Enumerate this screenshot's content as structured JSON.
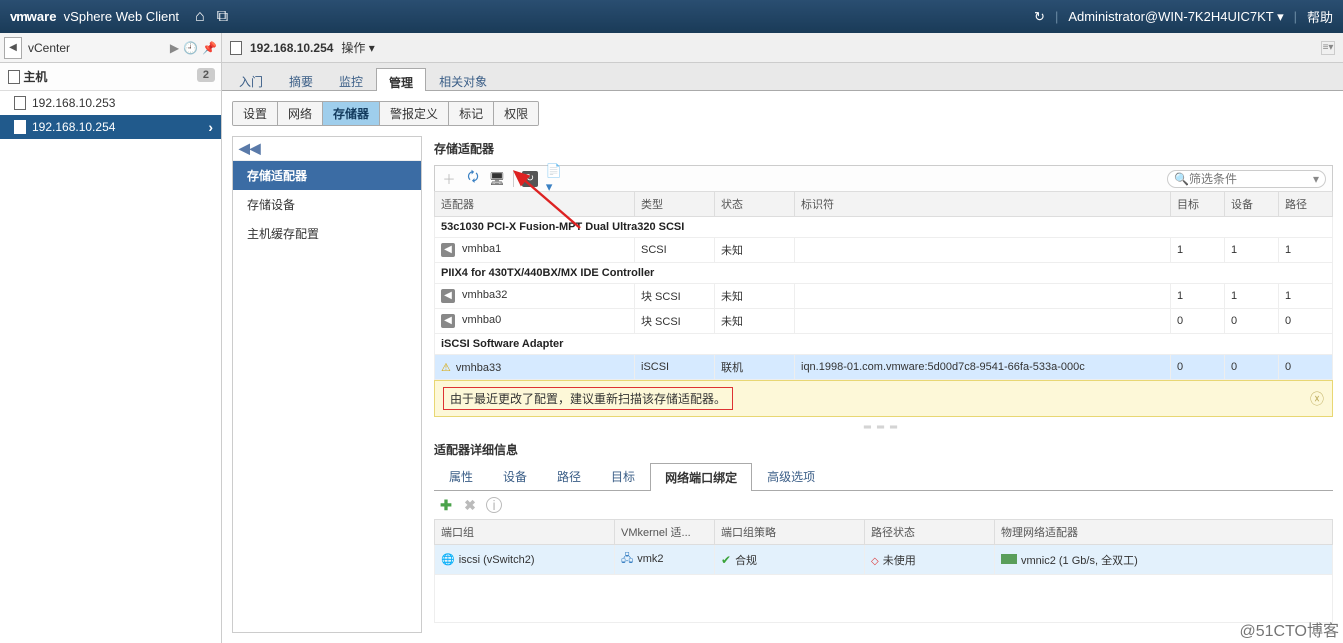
{
  "topbar": {
    "brand_prefix": "vm",
    "brand_suffix": "ware",
    "product": "vSphere Web Client",
    "user": "Administrator@WIN-7K2H4UIC7KT",
    "help": "帮助"
  },
  "left": {
    "breadcrumb": "vCenter",
    "section_title": "主机",
    "badge": "2",
    "hosts": [
      "192.168.10.253",
      "192.168.10.254"
    ],
    "selected": "192.168.10.254"
  },
  "object": {
    "title": "192.168.10.254",
    "actions_label": "操作 ▾"
  },
  "main_tabs": [
    "入门",
    "摘要",
    "监控",
    "管理",
    "相关对象"
  ],
  "main_tab_active": "管理",
  "sub_tabs": [
    "设置",
    "网络",
    "存储器",
    "警报定义",
    "标记",
    "权限"
  ],
  "sub_tab_active": "存储器",
  "inner_nav": {
    "collapse": "◀◀",
    "items": [
      "存储适配器",
      "存储设备",
      "主机缓存配置"
    ],
    "active": "存储适配器"
  },
  "adapters_section_title": "存储适配器",
  "filter_placeholder": "筛选条件",
  "adapter_table": {
    "headers": [
      "适配器",
      "类型",
      "状态",
      "标识符",
      "目标",
      "设备",
      "路径"
    ],
    "groups": [
      {
        "title": "53c1030 PCI-X Fusion-MPT Dual Ultra320 SCSI",
        "rows": [
          {
            "adapter": "vmhba1",
            "type": "SCSI",
            "status": "未知",
            "ident": "",
            "targets": "1",
            "devices": "1",
            "paths": "1",
            "icon": "hba"
          }
        ]
      },
      {
        "title": "PIIX4 for 430TX/440BX/MX IDE Controller",
        "rows": [
          {
            "adapter": "vmhba32",
            "type": "块 SCSI",
            "status": "未知",
            "ident": "",
            "targets": "1",
            "devices": "1",
            "paths": "1",
            "icon": "hba"
          },
          {
            "adapter": "vmhba0",
            "type": "块 SCSI",
            "status": "未知",
            "ident": "",
            "targets": "0",
            "devices": "0",
            "paths": "0",
            "icon": "hba"
          }
        ]
      },
      {
        "title": "iSCSI Software Adapter",
        "rows": [
          {
            "adapter": "vmhba33",
            "type": "iSCSI",
            "status": "联机",
            "ident": "iqn.1998-01.com.vmware:5d00d7c8-9541-66fa-533a-000c",
            "targets": "0",
            "devices": "0",
            "paths": "0",
            "icon": "warn",
            "selected": true
          }
        ]
      }
    ]
  },
  "alert_message": "由于最近更改了配置，建议重新扫描该存储适配器。",
  "detail_title": "适配器详细信息",
  "detail_tabs": [
    "属性",
    "设备",
    "路径",
    "目标",
    "网络端口绑定",
    "高级选项"
  ],
  "detail_tab_active": "网络端口绑定",
  "binding_table": {
    "headers": [
      "端口组",
      "VMkernel 适...",
      "端口组策略",
      "路径状态",
      "物理网络适配器"
    ],
    "row": {
      "portgroup": "iscsi (vSwitch2)",
      "vmkernel": "vmk2",
      "policy": "合规",
      "path_status": "未使用",
      "pnic": "vmnic2 (1 Gb/s, 全双工)"
    }
  },
  "watermark": "@51CTO博客"
}
